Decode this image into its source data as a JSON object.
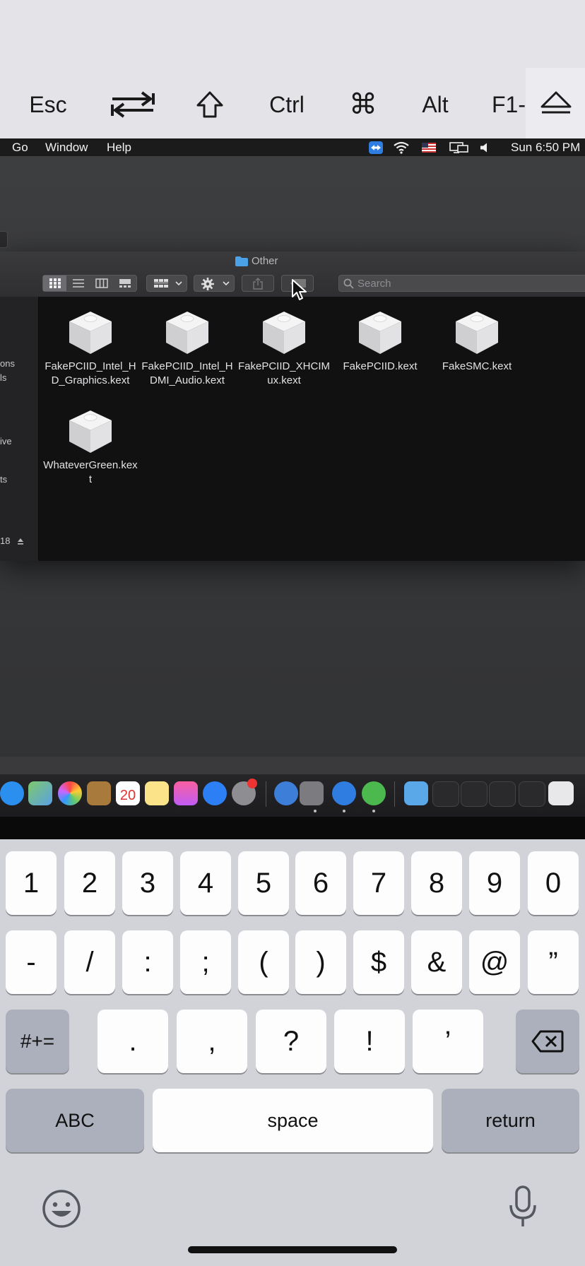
{
  "remote_keys": {
    "esc": "Esc",
    "tab_icon": "tab-arrows-icon",
    "shift_icon": "shift-arrow-icon",
    "ctrl": "Ctrl",
    "cmd": "⌘",
    "alt": "Alt",
    "fn": "F1-",
    "eject_icon": "eject-icon"
  },
  "menubar": {
    "items": [
      "Go",
      "Window",
      "Help"
    ],
    "status_icons": [
      "teamviewer-icon",
      "wifi-icon",
      "us-flag-icon",
      "display-icon",
      "volume-icon"
    ],
    "clock": "Sun 6:50 PM"
  },
  "finder": {
    "title": "Other",
    "search_placeholder": "Search",
    "sidebar_fragments": [
      "ons",
      "ls",
      "ive",
      "ts",
      "18"
    ],
    "files": [
      "FakePCIID_Intel_HD_Graphics.kext",
      "FakePCIID_Intel_HDMI_Audio.kext",
      "FakePCIID_XHCIMux.kext",
      "FakePCIID.kext",
      "FakeSMC.kext",
      "WhateverGreen.kext"
    ],
    "calendar_day": "20"
  },
  "keyboard": {
    "row1": [
      "1",
      "2",
      "3",
      "4",
      "5",
      "6",
      "7",
      "8",
      "9",
      "0"
    ],
    "row2": [
      "-",
      "/",
      ":",
      ";",
      "(",
      ")",
      "$",
      "&",
      "@",
      "”"
    ],
    "row3": [
      ".",
      ",",
      "?",
      "!",
      "’"
    ],
    "symbols_key": "#+=",
    "abc_key": "ABC",
    "space_key": "space",
    "return_key": "return"
  }
}
